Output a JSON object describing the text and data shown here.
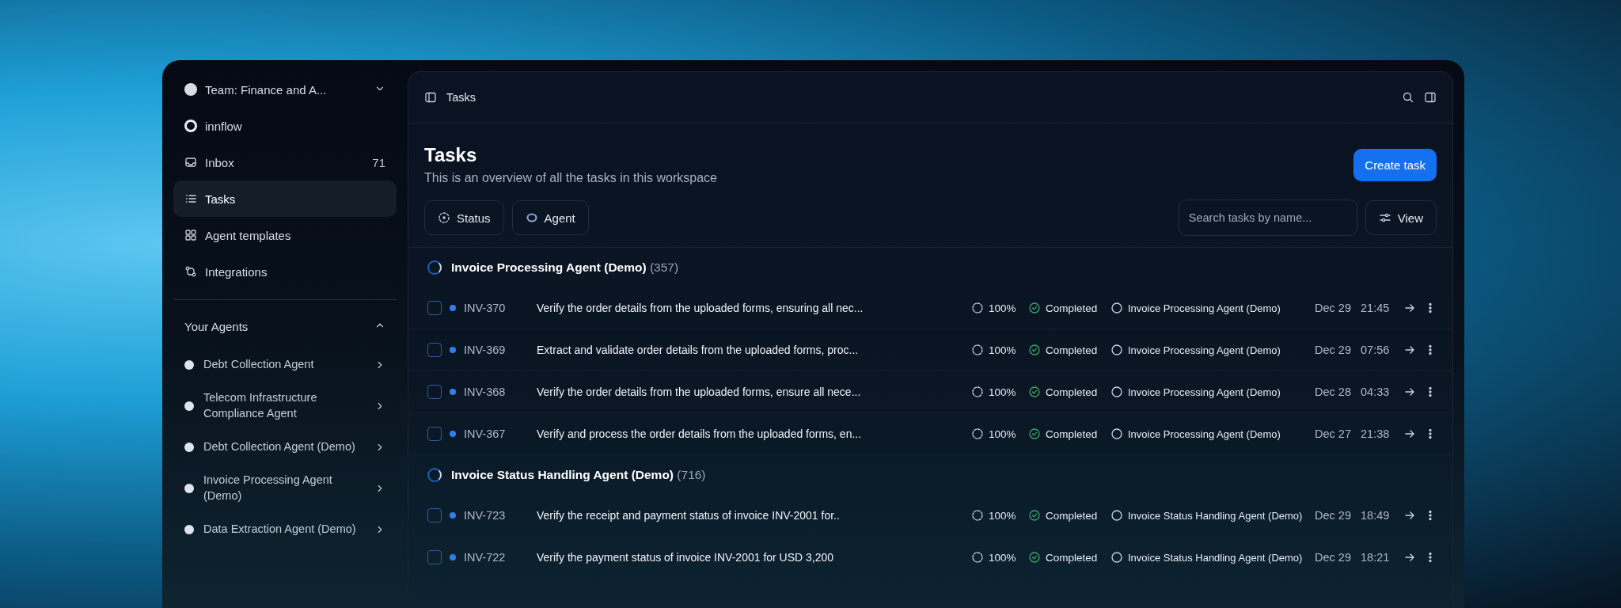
{
  "sidebar": {
    "team": {
      "label": "Team: Finance and A..."
    },
    "workspace": {
      "label": "innflow"
    },
    "nav": [
      {
        "label": "Inbox",
        "kind": "inbox",
        "count": "71",
        "selected": false
      },
      {
        "label": "Tasks",
        "kind": "list",
        "selected": true
      },
      {
        "label": "Agent templates",
        "kind": "grid",
        "selected": false
      },
      {
        "label": "Integrations",
        "kind": "integrations",
        "selected": false
      }
    ],
    "agents_section": {
      "title": "Your Agents",
      "expanded": true
    },
    "agents": [
      {
        "label": "Debt Collection Agent"
      },
      {
        "label": "Telecom Infrastructure Compliance Agent"
      },
      {
        "label": "Debt Collection Agent (Demo)"
      },
      {
        "label": "Invoice Processing Agent (Demo)"
      },
      {
        "label": "Data Extraction Agent (Demo)"
      }
    ]
  },
  "topbar": {
    "title": "Tasks"
  },
  "header": {
    "title": "Tasks",
    "subtitle": "This is an overview of all the tasks in this workspace",
    "create_button": "Create task"
  },
  "filters": [
    {
      "label": "Status",
      "kind": "status"
    },
    {
      "label": "Agent",
      "kind": "agent"
    }
  ],
  "search": {
    "placeholder": "Search tasks by name..."
  },
  "view_button": "View",
  "groups": [
    {
      "title": "Invoice Processing Agent (Demo)",
      "count": "(357)",
      "tasks": [
        {
          "id": "INV-370",
          "description": "Verify the order details from the uploaded forms, ensuring all nec...",
          "progress": "100%",
          "status": "Completed",
          "agent": "Invoice Processing Agent (Demo)",
          "date": "Dec 29",
          "time": "21:45",
          "checked": false
        },
        {
          "id": "INV-369",
          "description": "Extract and validate order details from the uploaded forms, proc...",
          "progress": "100%",
          "status": "Completed",
          "agent": "Invoice Processing Agent (Demo)",
          "date": "Dec 29",
          "time": "07:56",
          "checked": false
        },
        {
          "id": "INV-368",
          "description": "Verify the order details from the uploaded forms, ensure all nece...",
          "progress": "100%",
          "status": "Completed",
          "agent": "Invoice Processing Agent (Demo)",
          "date": "Dec 28",
          "time": "04:33",
          "checked": false
        },
        {
          "id": "INV-367",
          "description": "Verify and process the order details from the uploaded forms, en...",
          "progress": "100%",
          "status": "Completed",
          "agent": "Invoice Processing Agent (Demo)",
          "date": "Dec 27",
          "time": "21:38",
          "checked": false
        }
      ]
    },
    {
      "title": "Invoice Status Handling Agent (Demo)",
      "count": "(716)",
      "tasks": [
        {
          "id": "INV-723",
          "description": "Verify the receipt and payment status of invoice INV-2001 for..",
          "progress": "100%",
          "status": "Completed",
          "agent": "Invoice Status Handling Agent (Demo)",
          "date": "Dec 29",
          "time": "18:49",
          "checked": false
        },
        {
          "id": "INV-722",
          "description": "Verify the payment status of invoice INV-2001 for USD 3,200",
          "progress": "100%",
          "status": "Completed",
          "agent": "Invoice Status Handling Agent (Demo)",
          "date": "Dec 29",
          "time": "18:21",
          "checked": false
        }
      ]
    }
  ]
}
